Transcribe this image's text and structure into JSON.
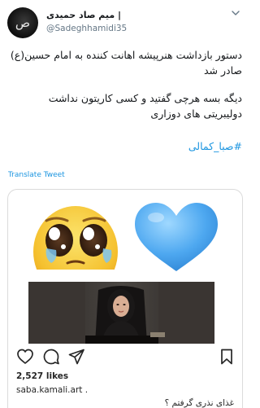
{
  "tweet": {
    "display_name": "میم صاد حمیدی |",
    "handle": "@Sadeghhamidi35",
    "avatar_label": "ص",
    "paragraphs": [
      "دستور بازداشت هنرپیشه اهانت کننده به امام حسین(ع) صادر شد",
      "دیگه بسه هرچی گفتید و کسی کاریتون نداشت دولیبریتی های دوزاری"
    ],
    "hashtag": "#صبا_کمالی",
    "translate_label": "Translate Tweet"
  },
  "instagram": {
    "emojis": [
      "pleading-tears-emoji",
      "blue-heart-emoji"
    ],
    "likes": "2,527 likes",
    "username": "saba.kamali.art",
    "username_suffix": " .",
    "caption": "غذای نذری گرفتم ؟"
  },
  "colors": {
    "link": "#1b95e0",
    "text": "#14171a",
    "muted": "#657786",
    "border": "#dbdbdb",
    "heart_blue": "#5ab4f4",
    "emoji_yellow": "#f7c23a"
  },
  "icons": {
    "header": "chevron-down-icon",
    "actions": [
      "heart-icon",
      "comment-icon",
      "share-icon",
      "bookmark-icon"
    ]
  }
}
